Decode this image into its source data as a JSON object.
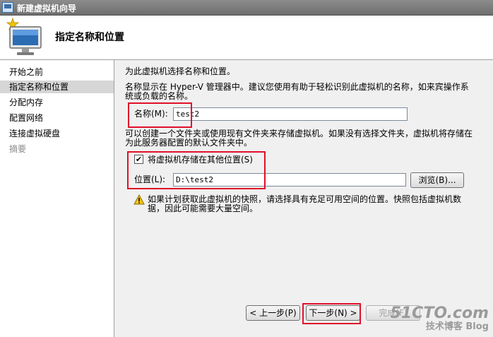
{
  "window": {
    "title": "新建虚拟机向导"
  },
  "header": {
    "page_title": "指定名称和位置"
  },
  "sidebar": {
    "items": [
      {
        "label": "开始之前",
        "state": "normal"
      },
      {
        "label": "指定名称和位置",
        "state": "active"
      },
      {
        "label": "分配内存",
        "state": "normal"
      },
      {
        "label": "配置网络",
        "state": "normal"
      },
      {
        "label": "连接虚拟硬盘",
        "state": "normal"
      },
      {
        "label": "摘要",
        "state": "disabled"
      }
    ]
  },
  "main": {
    "intro": "为此虚拟机选择名称和位置。",
    "name_hint_line1": "名称显示在 Hyper-V 管理器中。建议您使用有助于轻松识别此虚拟机的名称，如来宾操作系",
    "name_hint_line2": "统或负载的名称。",
    "name_label": "名称(M):",
    "name_value": "test2",
    "folder_hint_line1": "可以创建一个文件夹或使用现有文件夹来存储虚拟机。如果没有选择文件夹，虚拟机将存储在",
    "folder_hint_line2": "为此服务器配置的默认文件夹中。",
    "store_elsewhere_label": "将虚拟机存储在其他位置(S)",
    "store_elsewhere_checked": true,
    "check_mark": "✔",
    "location_label": "位置(L):",
    "location_value": "D:\\test2",
    "browse_label": "浏览(B)...",
    "warning_line1": "如果计划获取此虚拟机的快照，请选择具有充足可用空间的位置。快照包括虚拟机数",
    "warning_line2": "据，因此可能需要大量空间。"
  },
  "footer": {
    "prev_label": "< 上一步(P)",
    "next_label": "下一步(N) >",
    "finish_label": "完成(F)"
  },
  "watermark": {
    "main": "51CTO.com",
    "sub": "技术博客 Blog"
  },
  "colors": {
    "highlight_box": "#e0102a",
    "warning": "#f5c518"
  }
}
